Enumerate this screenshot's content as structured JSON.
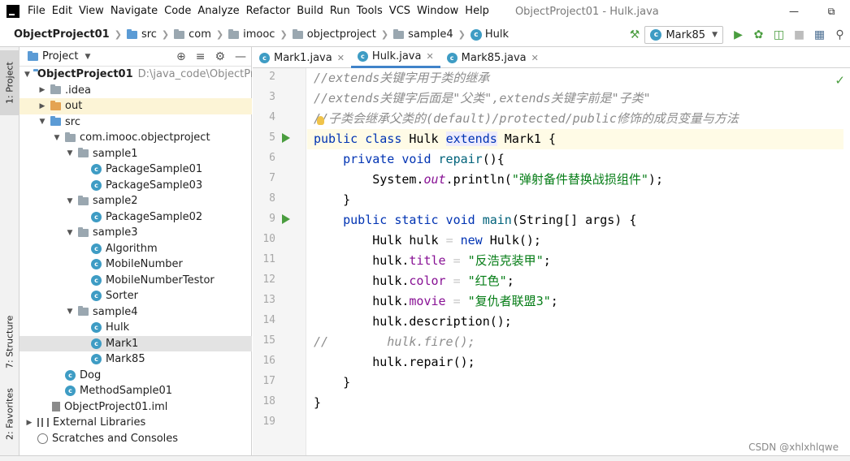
{
  "menu": {
    "items": [
      "File",
      "Edit",
      "View",
      "Navigate",
      "Code",
      "Analyze",
      "Refactor",
      "Build",
      "Run",
      "Tools",
      "VCS",
      "Window",
      "Help"
    ],
    "window_title": "ObjectProject01 - Hulk.java"
  },
  "breadcrumb": [
    "ObjectProject01",
    "src",
    "com",
    "imooc",
    "objectproject",
    "sample4",
    "Hulk"
  ],
  "toolbar": {
    "run_config": "Mark85"
  },
  "stripe": {
    "project": "1: Project",
    "structure": "7: Structure",
    "favorites": "2: Favorites"
  },
  "project_panel": {
    "title": "Project",
    "rows": [
      {
        "label": "ObjectProject01",
        "path": "D:\\java_code\\ObjectPro"
      },
      {
        "label": ".idea"
      },
      {
        "label": "out"
      },
      {
        "label": "src"
      },
      {
        "label": "com.imooc.objectproject"
      },
      {
        "label": "sample1"
      },
      {
        "label": "PackageSample01"
      },
      {
        "label": "PackageSample03"
      },
      {
        "label": "sample2"
      },
      {
        "label": "PackageSample02"
      },
      {
        "label": "sample3"
      },
      {
        "label": "Algorithm"
      },
      {
        "label": "MobileNumber"
      },
      {
        "label": "MobileNumberTestor"
      },
      {
        "label": "Sorter"
      },
      {
        "label": "sample4"
      },
      {
        "label": "Hulk"
      },
      {
        "label": "Mark1"
      },
      {
        "label": "Mark85"
      },
      {
        "label": "Dog"
      },
      {
        "label": "MethodSample01"
      },
      {
        "label": "ObjectProject01.iml"
      },
      {
        "label": "External Libraries"
      },
      {
        "label": "Scratches and Consoles"
      }
    ]
  },
  "editor_tabs": [
    {
      "label": "Mark1.java"
    },
    {
      "label": "Hulk.java"
    },
    {
      "label": "Mark85.java"
    }
  ],
  "line_numbers": [
    "2",
    "3",
    "4",
    "5",
    "6",
    "7",
    "8",
    "9",
    "10",
    "11",
    "12",
    "13",
    "14",
    "15",
    "16",
    "17",
    "18",
    "19"
  ],
  "code": {
    "l2": "//extends关键字用于类的继承",
    "l3": "//extends关键字后面是\"父类\",extends关键字前是\"子类\"",
    "l4": "//子类会继承父类的(default)/protected/public修饰的成员变量与方法",
    "l5_kw": "public class",
    "l5_name": " Hulk ",
    "l5_ext": "extends",
    "l5_rest": " Mark1 {",
    "l6_kw": "    private void",
    "l6_m": " repair",
    "l6_rest": "(){",
    "l7_a": "        System.",
    "l7_out": "out",
    "l7_b": ".println(",
    "l7_s": "\"弹射备件替换战损组件\"",
    "l7_c": ");",
    "l8": "    }",
    "l9_kw": "    public static void",
    "l9_m": " main",
    "l9_rest": "(String[] args) {",
    "l10_a": "        Hulk hulk ",
    "l10_eq": "=",
    "l10_kw": " new",
    "l10_b": " Hulk();",
    "l11_a": "        hulk.",
    "l11_f": "title",
    "l11_eq": " = ",
    "l11_s": "\"反浩克装甲\"",
    "l11_b": ";",
    "l12_a": "        hulk.",
    "l12_f": "color",
    "l12_eq": " = ",
    "l12_s": "\"红色\"",
    "l12_b": ";",
    "l13_a": "        hulk.",
    "l13_f": "movie",
    "l13_eq": " = ",
    "l13_s": "\"复仇者联盟3\"",
    "l13_b": ";",
    "l14": "        hulk.description();",
    "l15": "//        hulk.fire();",
    "l16": "        hulk.repair();",
    "l17": "    }",
    "l18": "}",
    "l19": ""
  },
  "watermark": "CSDN @xhlxhlqwe"
}
